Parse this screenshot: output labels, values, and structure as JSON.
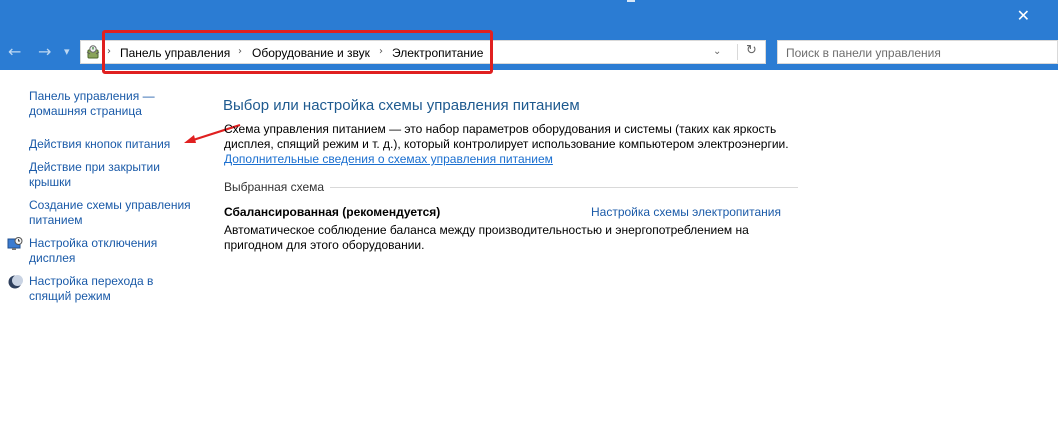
{
  "window": {
    "close_glyph": "✕"
  },
  "nav": {
    "back_glyph": "←",
    "forward_glyph": "→",
    "recent_glyph": "▾",
    "up_glyph": "↑"
  },
  "breadcrumb": {
    "items": [
      "Панель управления",
      "Оборудование и звук",
      "Электропитание"
    ],
    "separator": "›",
    "dropdown_glyph": "⌄",
    "refresh_glyph": "↻"
  },
  "search": {
    "placeholder": "Поиск в панели управления"
  },
  "sidebar": {
    "home_link": [
      "Панель управления —",
      "домашняя страница"
    ],
    "items": [
      {
        "lines": [
          "Действия кнопок питания"
        ],
        "icon": null
      },
      {
        "lines": [
          "Действие при закрытии",
          "крышки"
        ],
        "icon": null
      },
      {
        "lines": [
          "Создание схемы управления",
          "питанием"
        ],
        "icon": null
      },
      {
        "lines": [
          "Настройка отключения",
          "дисплея"
        ],
        "icon": "monitor-clock-icon"
      },
      {
        "lines": [
          "Настройка перехода в",
          "спящий режим"
        ],
        "icon": "moon-icon"
      }
    ]
  },
  "main": {
    "title": "Выбор или настройка схемы управления питанием",
    "description": "Схема управления питанием — это набор параметров оборудования и системы (таких как яркость дисплея, спящий режим и т. д.), который контролирует использование компьютером электроэнергии.",
    "more_link": "Дополнительные сведения о схемах управления питанием",
    "selected_section_label": "Выбранная схема",
    "plan": {
      "name": "Сбалансированная (рекомендуется)",
      "settings_link": "Настройка схемы электропитания",
      "description": "Автоматическое соблюдение баланса между производительностью и энергопотреблением на пригодном для этого оборудовании."
    }
  },
  "colors": {
    "titlebar": "#2b7cd3",
    "link": "#1a5aa8",
    "heading": "#1e5a8f",
    "annotation_red": "#e02020"
  }
}
